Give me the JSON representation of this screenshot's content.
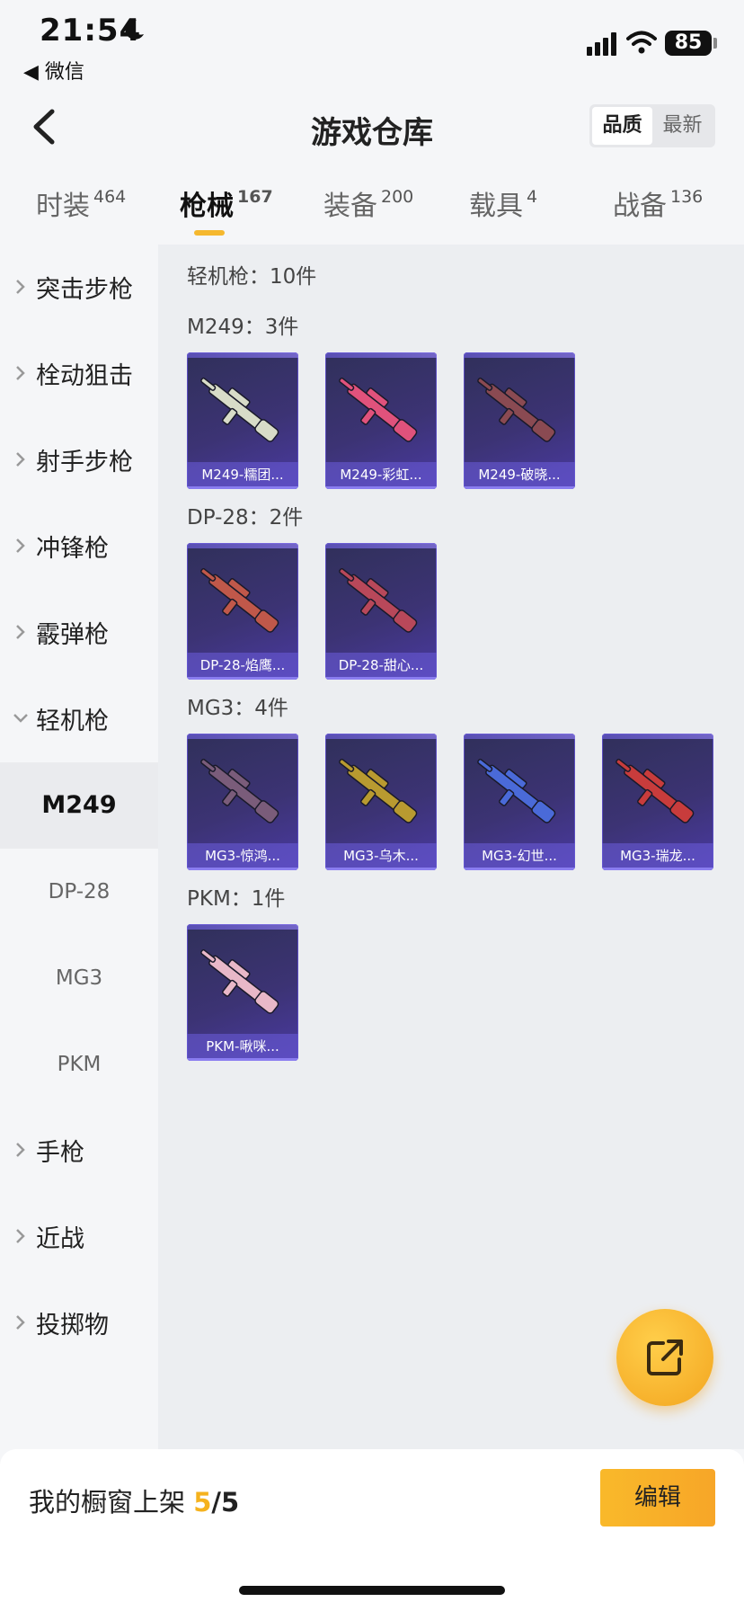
{
  "status_bar": {
    "time": "21:54",
    "back_app": "◀ 微信",
    "battery": "85"
  },
  "header": {
    "title": "游戏仓库",
    "sort_options": [
      "品质",
      "最新"
    ]
  },
  "tabs": [
    {
      "label": "时装",
      "count": "464"
    },
    {
      "label": "枪械",
      "count": "167"
    },
    {
      "label": "装备",
      "count": "200"
    },
    {
      "label": "载具",
      "count": "4"
    },
    {
      "label": "战备",
      "count": "136"
    }
  ],
  "sidebar": {
    "categories": [
      "突击步枪",
      "栓动狙击",
      "射手步枪",
      "冲锋枪",
      "霰弹枪",
      "轻机枪"
    ],
    "subitems": [
      "M249",
      "DP-28",
      "MG3",
      "PKM"
    ],
    "categories_after": [
      "手枪",
      "近战",
      "投掷物"
    ]
  },
  "main": {
    "summary": "轻机枪：10件",
    "groups": [
      {
        "title": "M249：3件",
        "items": [
          "M249-糯团...",
          "M249-彩虹...",
          "M249-破晓..."
        ]
      },
      {
        "title": "DP-28：2件",
        "items": [
          "DP-28-焰鹰...",
          "DP-28-甜心..."
        ]
      },
      {
        "title": "MG3：4件",
        "items": [
          "MG3-惊鸿...",
          "MG3-乌木...",
          "MG3-幻世...",
          "MG3-瑞龙..."
        ]
      },
      {
        "title": "PKM：1件",
        "items": [
          "PKM-啾咪..."
        ]
      }
    ],
    "item_colors": [
      "#d8dcc8",
      "#e0527c",
      "#8a4a52",
      "#c0584a",
      "#b8485a",
      "#7a5c7a",
      "#b89a30",
      "#4a6ad8",
      "#c83c3c",
      "#e8b8c8"
    ]
  },
  "bottom": {
    "label": "我的橱窗上架",
    "current": "5",
    "total": "/5",
    "edit": "编辑"
  },
  "colors": {
    "accent": "#f5b82e",
    "card_bg": "#3c3374"
  }
}
